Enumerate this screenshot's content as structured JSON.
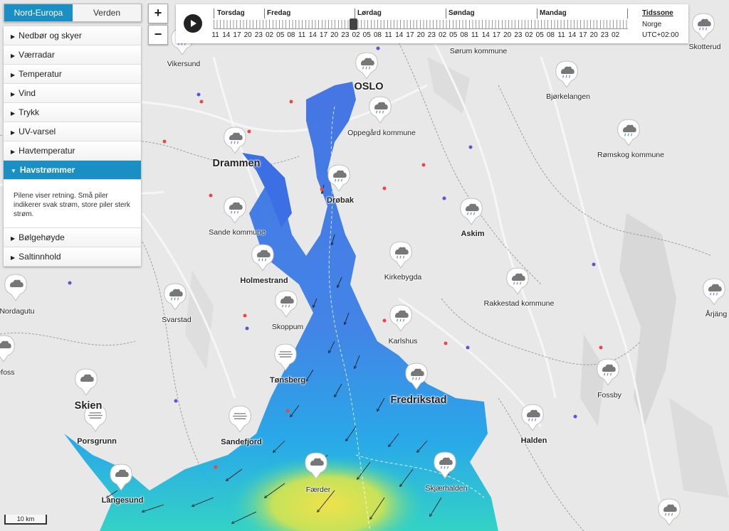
{
  "region_tabs": [
    "Nord-Europa",
    "Verden"
  ],
  "layers": {
    "items": [
      "Nedbør og skyer",
      "Værradar",
      "Temperatur",
      "Vind",
      "Trykk",
      "UV-varsel",
      "Havtemperatur",
      "Havstrømmer",
      "Bølgehøyde",
      "Saltinnhold"
    ],
    "active": "Havstrømmer",
    "active_description": "Pilene viser retning. Små piler indikerer svak strøm, store piler sterk strøm."
  },
  "zoom": {
    "in_label": "+",
    "out_label": "−"
  },
  "timeline": {
    "days": [
      "Torsdag",
      "Fredag",
      "Lørdag",
      "Søndag",
      "Mandag"
    ],
    "hours": [
      "11",
      "14",
      "17",
      "20",
      "23",
      "02",
      "05",
      "08",
      "11",
      "14",
      "17",
      "20",
      "23",
      "02",
      "05",
      "08",
      "11",
      "14",
      "17",
      "20",
      "23",
      "02",
      "05",
      "08",
      "11",
      "14",
      "17",
      "20",
      "23",
      "02",
      "05",
      "08",
      "11",
      "14",
      "17",
      "20",
      "23",
      "02"
    ],
    "timezone_title": "Tidssone",
    "timezone_name": "Norge",
    "timezone_offset": "UTC+02:00",
    "play_icon": "play-icon"
  },
  "places": [
    {
      "name": "Vikersund",
      "style": "normal"
    },
    {
      "name": "OSLO",
      "style": "big"
    },
    {
      "name": "Oppegård kommune",
      "style": "normal"
    },
    {
      "name": "Sørum kommune",
      "style": "normal"
    },
    {
      "name": "Bjørkelangen",
      "style": "normal"
    },
    {
      "name": "Rømskog kommune",
      "style": "normal"
    },
    {
      "name": "Skotterud",
      "style": "normal"
    },
    {
      "name": "Drammen",
      "style": "big"
    },
    {
      "name": "Drøbak",
      "style": "bold"
    },
    {
      "name": "Sande kommune",
      "style": "normal"
    },
    {
      "name": "Askim",
      "style": "bold"
    },
    {
      "name": "Holmestrand",
      "style": "bold"
    },
    {
      "name": "Kirkebygda",
      "style": "normal"
    },
    {
      "name": "Rakkestad kommune",
      "style": "normal"
    },
    {
      "name": "Årjäng",
      "style": "normal"
    },
    {
      "name": "Nordagutu",
      "style": "normal"
    },
    {
      "name": "Svarstad",
      "style": "normal"
    },
    {
      "name": "Skoppum",
      "style": "normal"
    },
    {
      "name": "Karlshus",
      "style": "normal"
    },
    {
      "name": "efoss",
      "style": "normal"
    },
    {
      "name": "Tønsberg",
      "style": "bold"
    },
    {
      "name": "Fredrikstad",
      "style": "big"
    },
    {
      "name": "Fossby",
      "style": "normal"
    },
    {
      "name": "Skien",
      "style": "big"
    },
    {
      "name": "Porsgrunn",
      "style": "bold"
    },
    {
      "name": "Sandefjord",
      "style": "bold"
    },
    {
      "name": "Halden",
      "style": "bold"
    },
    {
      "name": "Langesund",
      "style": "bold"
    },
    {
      "name": "Færder",
      "style": "normal"
    },
    {
      "name": "Skjærhalden",
      "style": "normal"
    }
  ],
  "weather_icons": [
    "rain-cloud-icon",
    "cloud-icon",
    "fog-icon"
  ],
  "scale_label": "10 km",
  "colors": {
    "accent": "#1a8fc4",
    "current_weak": "#3e6fe0",
    "current_medium": "#1fa7e6",
    "current_strong": "#29d3c0",
    "current_max": "#e6e04a"
  }
}
